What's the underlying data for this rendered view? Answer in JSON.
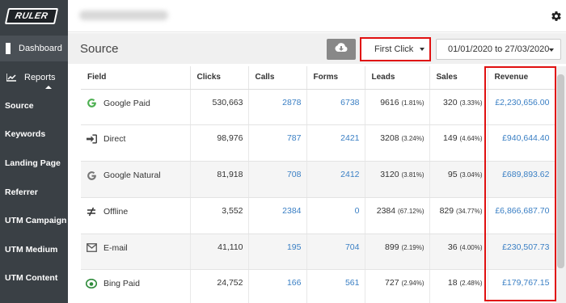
{
  "app": {
    "logo_text": "RULER"
  },
  "sidebar": {
    "dashboard_label": "Dashboard",
    "reports_label": "Reports",
    "sub_items": [
      "Source",
      "Keywords",
      "Landing Page",
      "Referrer",
      "UTM Campaign",
      "UTM Medium",
      "UTM Content"
    ]
  },
  "header": {
    "page_title": "Source"
  },
  "toolbar": {
    "attribution_value": "First Click",
    "date_range": "01/01/2020 to 27/03/2020"
  },
  "table": {
    "columns": [
      "Field",
      "Clicks",
      "Calls",
      "Forms",
      "Leads",
      "Sales",
      "Revenue"
    ],
    "rows": [
      {
        "icon": "google-icon",
        "field": "Google Paid",
        "clicks": "530,663",
        "calls": "2878",
        "forms": "6738",
        "leads": "9616",
        "leads_pct": "(1.81%)",
        "sales": "320",
        "sales_pct": "(3.33%)",
        "revenue": "£2,230,656.00"
      },
      {
        "icon": "sign-in-icon",
        "field": "Direct",
        "clicks": "98,976",
        "calls": "787",
        "forms": "2421",
        "leads": "3208",
        "leads_pct": "(3.24%)",
        "sales": "149",
        "sales_pct": "(4.64%)",
        "revenue": "£940,644.40"
      },
      {
        "icon": "google-icon",
        "field": "Google Natural",
        "clicks": "81,918",
        "calls": "708",
        "forms": "2412",
        "leads": "3120",
        "leads_pct": "(3.81%)",
        "sales": "95",
        "sales_pct": "(3.04%)",
        "revenue": "£689,893.62"
      },
      {
        "icon": "not-equal-icon",
        "field": "Offline",
        "clicks": "3,552",
        "calls": "2384",
        "forms": "0",
        "leads": "2384",
        "leads_pct": "(67.12%)",
        "sales": "829",
        "sales_pct": "(34.77%)",
        "revenue": "£6,866,687.70"
      },
      {
        "icon": "envelope-icon",
        "field": "E-mail",
        "clicks": "41,110",
        "calls": "195",
        "forms": "704",
        "leads": "899",
        "leads_pct": "(2.19%)",
        "sales": "36",
        "sales_pct": "(4.00%)",
        "revenue": "£230,507.73"
      },
      {
        "icon": "bing-icon",
        "field": "Bing Paid",
        "clicks": "24,752",
        "calls": "166",
        "forms": "561",
        "leads": "727",
        "leads_pct": "(2.94%)",
        "sales": "18",
        "sales_pct": "(2.48%)",
        "revenue": "£179,767.15"
      }
    ]
  },
  "colors": {
    "sidebar_bg": "#3a4045",
    "link": "#3a7fc4",
    "highlight": "#e01010",
    "google_green": "#4caf50"
  }
}
